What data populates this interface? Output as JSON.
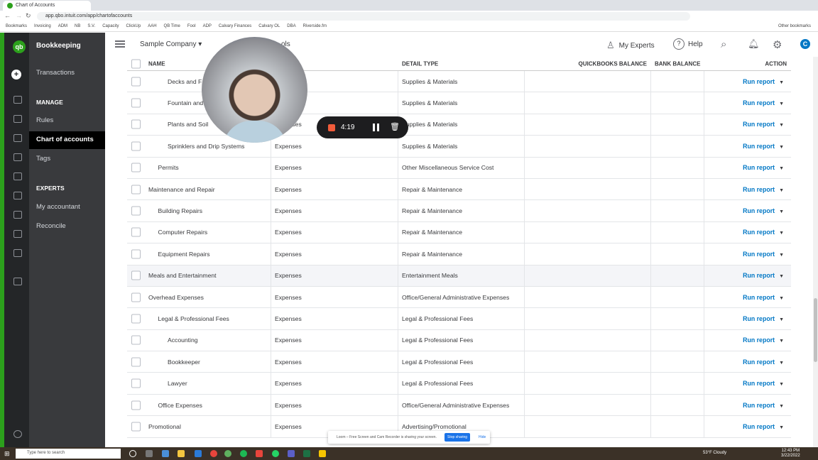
{
  "browser": {
    "tab_title": "Chart of Accounts",
    "url": "app.qbo.intuit.com/app/chartofaccounts",
    "bookmarks": [
      "Bookmarks",
      "Invoicing",
      "ADM",
      "NB",
      "S.V.",
      "Capacity",
      "ClickUp",
      "AAH",
      "QB Time",
      "Fool",
      "ADP",
      "Calvary Finances",
      "Calvary OL",
      "DBA",
      "Riverside.fm",
      "Other bookmarks"
    ]
  },
  "sidebar": {
    "brand": "Bookkeeping",
    "logo": "qb",
    "transactions": "Transactions",
    "manage_heading": "MANAGE",
    "rules": "Rules",
    "chart_of_accounts": "Chart of accounts",
    "tags": "Tags",
    "experts_heading": "EXPERTS",
    "my_accountant": "My accountant",
    "reconcile": "Reconcile"
  },
  "header": {
    "company": "Sample Company",
    "tools": "ols",
    "my_experts": "My Experts",
    "help": "Help",
    "avatar": "C"
  },
  "table": {
    "columns": {
      "name": "NAME",
      "type": "",
      "detail": "DETAIL TYPE",
      "qb_balance": "QUICKBOOKS BALANCE",
      "bank_balance": "BANK BALANCE",
      "action": "ACTION"
    },
    "action_label": "Run report",
    "rows": [
      {
        "name": "Decks and F",
        "level": 2,
        "type": "",
        "detail": "Supplies & Materials"
      },
      {
        "name": "Fountain and",
        "level": 2,
        "type": "",
        "detail": "Supplies & Materials"
      },
      {
        "name": "Plants and Soil",
        "level": 2,
        "type": "Expenses",
        "detail": "Supplies & Materials"
      },
      {
        "name": "Sprinklers and Drip Systems",
        "level": 2,
        "type": "Expenses",
        "detail": "Supplies & Materials"
      },
      {
        "name": "Permits",
        "level": 1,
        "type": "Expenses",
        "detail": "Other Miscellaneous Service Cost"
      },
      {
        "name": "Maintenance and Repair",
        "level": 0,
        "type": "Expenses",
        "detail": "Repair & Maintenance"
      },
      {
        "name": "Building Repairs",
        "level": 1,
        "type": "Expenses",
        "detail": "Repair & Maintenance"
      },
      {
        "name": "Computer Repairs",
        "level": 1,
        "type": "Expenses",
        "detail": "Repair & Maintenance"
      },
      {
        "name": "Equipment Repairs",
        "level": 1,
        "type": "Expenses",
        "detail": "Repair & Maintenance"
      },
      {
        "name": "Meals and Entertainment",
        "level": 0,
        "type": "Expenses",
        "detail": "Entertainment Meals",
        "hover": true
      },
      {
        "name": "Overhead Expenses",
        "level": 0,
        "type": "Expenses",
        "detail": "Office/General Administrative Expenses"
      },
      {
        "name": "Legal & Professional Fees",
        "level": 1,
        "type": "Expenses",
        "detail": "Legal & Professional Fees"
      },
      {
        "name": "Accounting",
        "level": 2,
        "type": "Expenses",
        "detail": "Legal & Professional Fees"
      },
      {
        "name": "Bookkeeper",
        "level": 2,
        "type": "Expenses",
        "detail": "Legal & Professional Fees"
      },
      {
        "name": "Lawyer",
        "level": 2,
        "type": "Expenses",
        "detail": "Legal & Professional Fees"
      },
      {
        "name": "Office Expenses",
        "level": 1,
        "type": "Expenses",
        "detail": "Office/General Administrative Expenses"
      },
      {
        "name": "Promotional",
        "level": 0,
        "type": "Expenses",
        "detail": "Advertising/Promotional"
      }
    ]
  },
  "recorder": {
    "time": "4:19"
  },
  "loom_banner": {
    "message": "Loom – Free Screen and Cam Recorder is sharing your screen.",
    "stop": "Stop sharing",
    "hide": "Hide"
  },
  "taskbar": {
    "search": "Type here to search",
    "weather": "53°F Cloudy",
    "time": "12:43 PM",
    "date": "3/22/2022"
  },
  "colors": {
    "brand_green": "#2ca01c",
    "link_blue": "#0077c5",
    "sidebar": "#393a3d"
  }
}
